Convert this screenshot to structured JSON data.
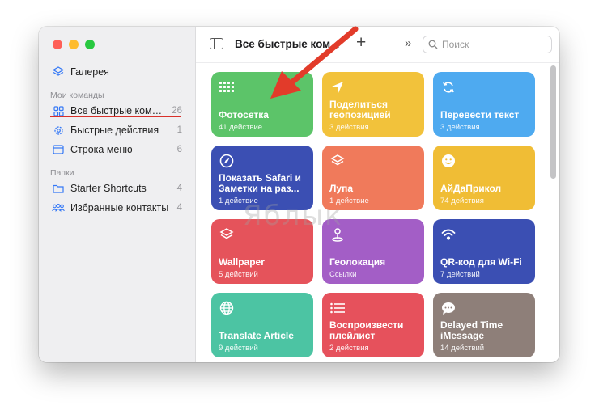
{
  "sidebar": {
    "gallery_label": "Галерея",
    "section_my": "Мои команды",
    "items": [
      {
        "label": "Все быстрые коман...",
        "count": "26"
      },
      {
        "label": "Быстрые действия",
        "count": "1"
      },
      {
        "label": "Строка меню",
        "count": "6"
      }
    ],
    "section_folders": "Папки",
    "folders": [
      {
        "label": "Starter Shortcuts",
        "count": "4"
      },
      {
        "label": "Избранные контакты",
        "count": "4"
      }
    ]
  },
  "toolbar": {
    "title": "Все быстрые ком...",
    "plus": "+",
    "chevrons": "»",
    "search_placeholder": "Поиск"
  },
  "cards": [
    {
      "title": "Фотосетка",
      "subtitle": "41 действие",
      "color": "#5cc469",
      "icon": "grid-icon"
    },
    {
      "title": "Поделиться геопозицией",
      "subtitle": "3 действия",
      "color": "#f2c23b",
      "icon": "location-arrow-icon"
    },
    {
      "title": "Перевести текст",
      "subtitle": "3 действия",
      "color": "#4eaaf0",
      "icon": "refresh-icon"
    },
    {
      "title": "Показать Safari и Заметки на раз...",
      "subtitle": "1 действие",
      "color": "#3b4fb3",
      "icon": "compass-icon"
    },
    {
      "title": "Лупа",
      "subtitle": "1 действие",
      "color": "#f07a5b",
      "icon": "layers-icon"
    },
    {
      "title": "АйДаПрикол",
      "subtitle": "74 действия",
      "color": "#f0bd35",
      "icon": "smiley-icon"
    },
    {
      "title": "Wallpaper",
      "subtitle": "5 действий",
      "color": "#e5535b",
      "icon": "layers-icon"
    },
    {
      "title": "Геолокация",
      "subtitle": "Ссылки",
      "color": "#a35ec6",
      "icon": "pin-icon"
    },
    {
      "title": "QR-код для Wi-Fi",
      "subtitle": "7 действий",
      "color": "#3b4fb3",
      "icon": "wifi-icon"
    },
    {
      "title": "Translate Article",
      "subtitle": "9 действий",
      "color": "#4cc4a3",
      "icon": "globe-icon"
    },
    {
      "title": "Воспроизвести плейлист",
      "subtitle": "2 действия",
      "color": "#e6515c",
      "icon": "list-icon"
    },
    {
      "title": "Delayed Time iMessage",
      "subtitle": "14 действий",
      "color": "#8e7f79",
      "icon": "message-icon"
    }
  ],
  "watermark": "Яблык",
  "colors": {
    "annotation_arrow": "#e23b2a",
    "underline": "#d9302a",
    "accent": "#3478f6"
  }
}
